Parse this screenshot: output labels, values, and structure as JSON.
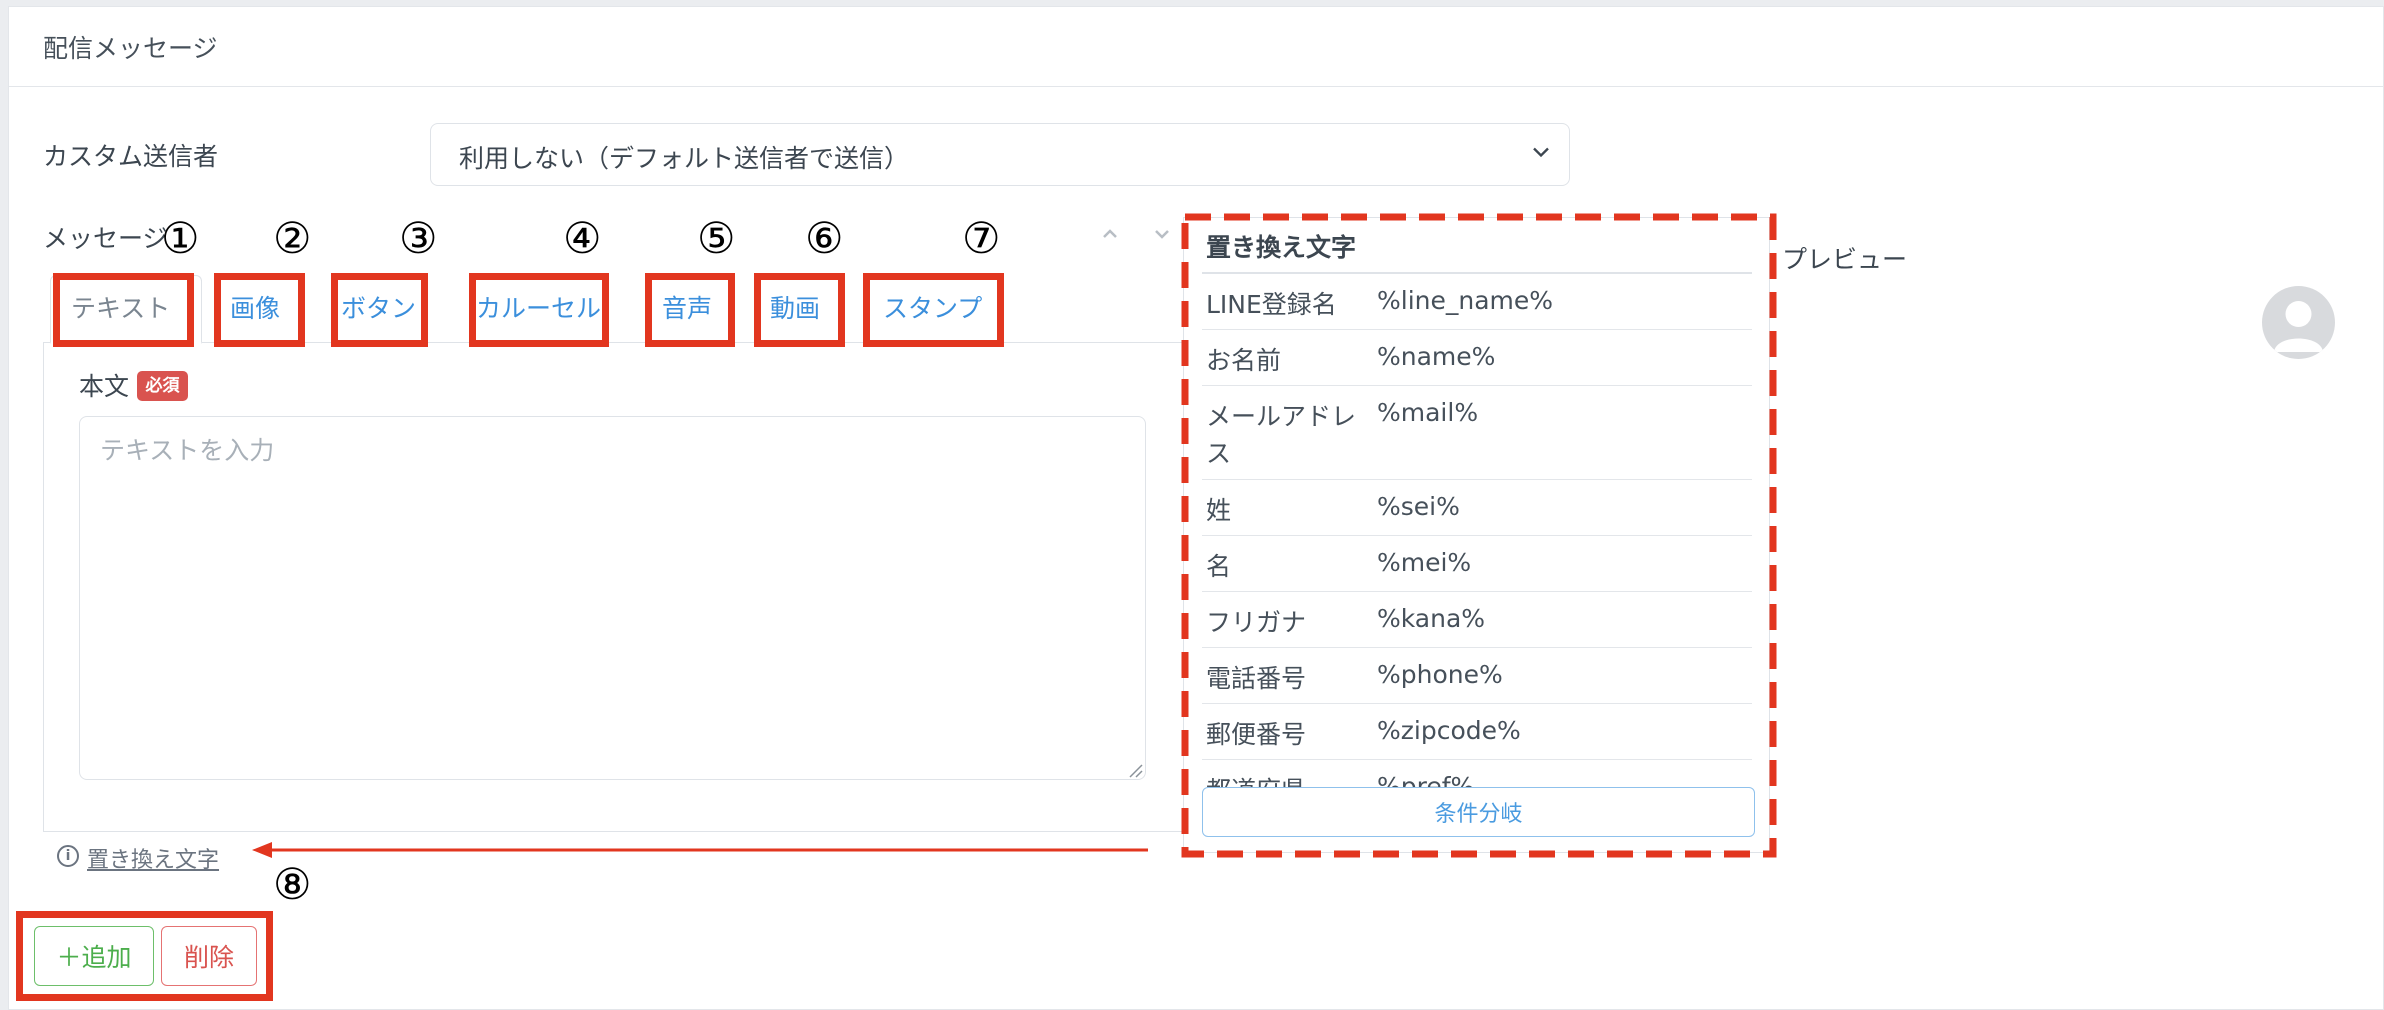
{
  "card": {
    "title": "配信メッセージ"
  },
  "sender": {
    "label": "カスタム送信者",
    "value": "利用しない（デフォルト送信者で送信）"
  },
  "message": {
    "label": "メッセージ"
  },
  "tabs": [
    {
      "label": "テキスト",
      "marker": "①"
    },
    {
      "label": "画像",
      "marker": "②"
    },
    {
      "label": "ボタン",
      "marker": "③"
    },
    {
      "label": "カルーセル",
      "marker": "④"
    },
    {
      "label": "音声",
      "marker": "⑤"
    },
    {
      "label": "動画",
      "marker": "⑥"
    },
    {
      "label": "スタンプ",
      "marker": "⑦"
    }
  ],
  "body": {
    "label": "本文",
    "required_badge": "必須",
    "placeholder": "テキストを入力"
  },
  "replace_link": {
    "label": "置き換え文字",
    "marker": "⑧"
  },
  "actions": {
    "add_label": "＋追加",
    "delete_label": "削除"
  },
  "replace_panel": {
    "title": "置き換え文字",
    "rows": [
      {
        "key": "LINE登録名",
        "value": "%line_name%"
      },
      {
        "key": "お名前",
        "value": "%name%"
      },
      {
        "key": "メールアドレス",
        "value": "%mail%"
      },
      {
        "key": "姓",
        "value": "%sei%"
      },
      {
        "key": "名",
        "value": "%mei%"
      },
      {
        "key": "フリガナ",
        "value": "%kana%"
      },
      {
        "key": "電話番号",
        "value": "%phone%"
      },
      {
        "key": "郵便番号",
        "value": "%zipcode%"
      },
      {
        "key": "都道府県",
        "value": "%pref%"
      }
    ],
    "branch_button": "条件分岐"
  },
  "preview": {
    "label": "プレビュー"
  },
  "colors": {
    "annotation_red": "#e2361f",
    "link_blue": "#3b8fdc",
    "add_green": "#4cae4c",
    "delete_red": "#d9534f"
  },
  "icons": [
    "chevron-down-icon",
    "chevron-up-icon",
    "info-icon",
    "avatar-icon",
    "arrow-left-icon"
  ]
}
